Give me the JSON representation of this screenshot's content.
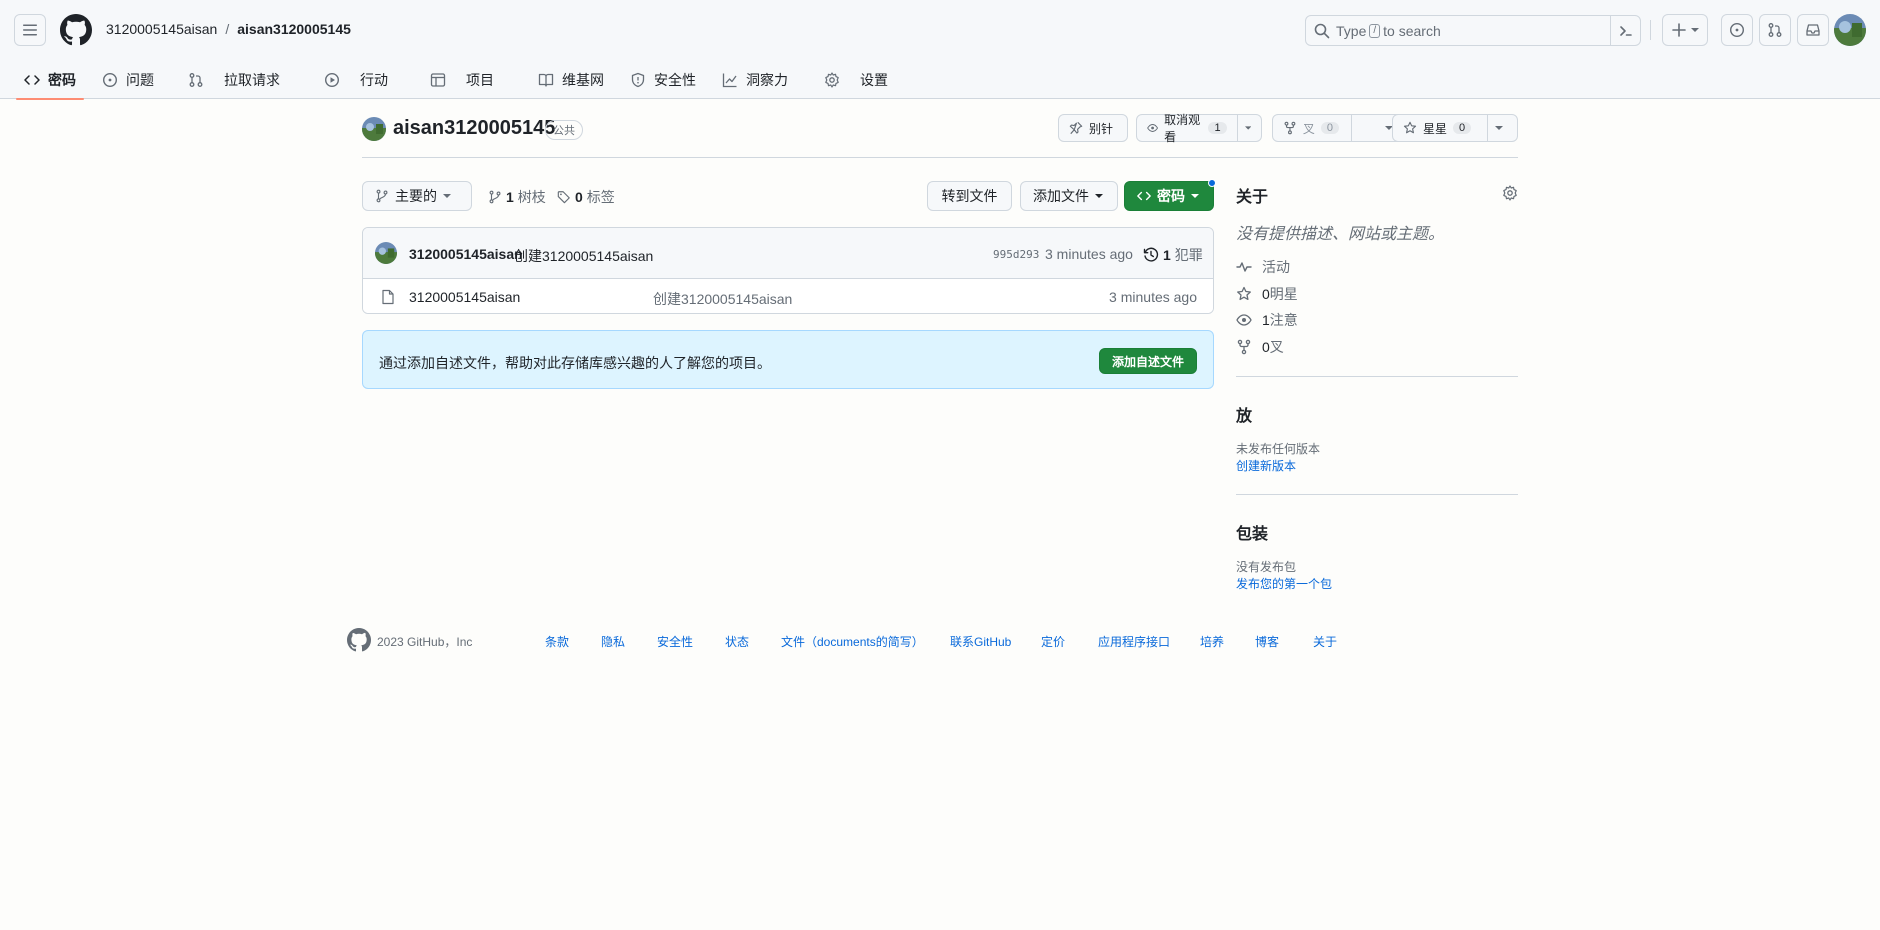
{
  "header": {
    "owner": "3120005145aisan",
    "separator": "/",
    "repo": "aisan3120005145",
    "search_prefix": "Type",
    "search_key": "/",
    "search_suffix": "to search"
  },
  "nav": {
    "tabs": [
      {
        "label": "密码",
        "icon": "code-icon",
        "active": true
      },
      {
        "label": "问题",
        "icon": "issue-icon"
      },
      {
        "label": "拉取请求",
        "icon": "pull-request-icon"
      },
      {
        "label": "行动",
        "icon": "play-icon"
      },
      {
        "label": "项目",
        "icon": "table-icon"
      },
      {
        "label": "维基网",
        "icon": "book-icon"
      },
      {
        "label": "安全性",
        "icon": "shield-icon"
      },
      {
        "label": "洞察力",
        "icon": "graph-icon"
      },
      {
        "label": "设置",
        "icon": "gear-icon"
      }
    ]
  },
  "repo_head": {
    "title": "aisan3120005145",
    "visibility": "公共",
    "pin_label": "别针",
    "watch_label": "取消观看",
    "watch_count": "1",
    "fork_label": "叉",
    "fork_count": "0",
    "star_label": "星星",
    "star_count": "0"
  },
  "toolbar": {
    "branch": "主要的",
    "branches_count": "1",
    "branches_label": "树枝",
    "tags_count": "0",
    "tags_label": "标签",
    "goto_file": "转到文件",
    "add_file": "添加文件",
    "code": "密码"
  },
  "commit": {
    "author": "3120005145aisan",
    "message": "创建3120005145aisan",
    "sha": "995d293",
    "time": "3 minutes ago",
    "history_count": "1",
    "history_label": "犯罪"
  },
  "files": [
    {
      "name": "3120005145aisan",
      "message": "创建3120005145aisan",
      "time": "3 minutes ago"
    }
  ],
  "readme_banner": {
    "text": "通过添加自述文件，帮助对此存储库感兴趣的人了解您的项目。",
    "button": "添加自述文件"
  },
  "sidebar": {
    "about_title": "关于",
    "about_desc": "没有提供描述、网站或主题。",
    "activity": "活动",
    "stars_count": "0",
    "stars_label": "明星",
    "watching_count": "1",
    "watching_label": "注意",
    "forks_count": "0",
    "forks_label": "叉",
    "releases_title": "放",
    "releases_none": "未发布任何版本",
    "releases_link": "创建新版本",
    "packages_title": "包装",
    "packages_none": "没有发布包",
    "packages_link": "发布您的第一个包"
  },
  "footer": {
    "copyright": "2023 GitHub，Inc",
    "links": [
      "条款",
      "隐私",
      "安全性",
      "状态",
      "文件（documents的简写）",
      "联系GitHub",
      "定价",
      "应用程序接口",
      "培养",
      "博客",
      "关于"
    ]
  },
  "colors": {
    "accent_green": "#1f883d",
    "link_blue": "#0969da",
    "tab_underline": "#fd8c73",
    "banner_bg": "#ddf4ff"
  }
}
